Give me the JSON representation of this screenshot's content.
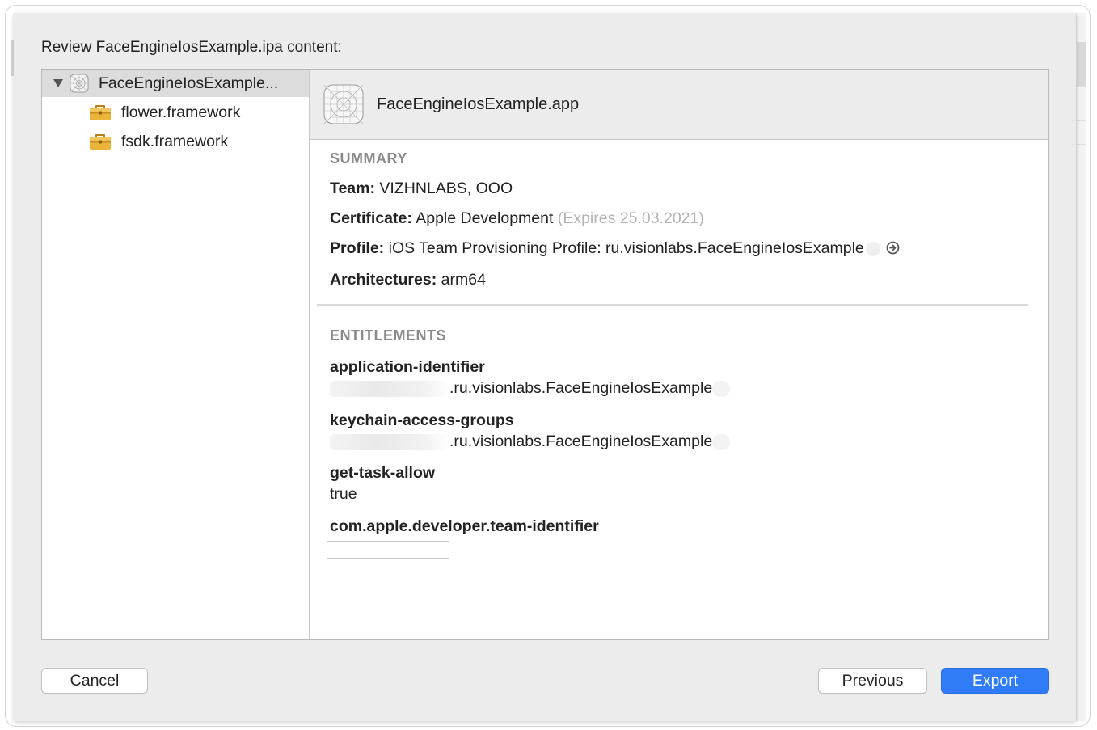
{
  "dialog": {
    "title": "Review FaceEngineIosExample.ipa content:"
  },
  "sidebar": {
    "items": [
      {
        "label": "FaceEngineIosExample...",
        "icon": "app-icon",
        "selected": true,
        "expanded": true
      },
      {
        "label": "flower.framework",
        "icon": "framework-folder-icon"
      },
      {
        "label": "fsdk.framework",
        "icon": "framework-folder-icon"
      }
    ]
  },
  "detail": {
    "header_title": "FaceEngineIosExample.app",
    "summary": {
      "title": "SUMMARY",
      "team_key": "Team:",
      "team_value": "VIZHNLABS, OOO",
      "certificate_key": "Certificate:",
      "certificate_value": "Apple Development",
      "certificate_expires": "(Expires 25.03.2021)",
      "profile_key": "Profile:",
      "profile_value": "iOS Team Provisioning Profile: ru.visionlabs.FaceEngineIosExample",
      "architectures_key": "Architectures:",
      "architectures_value": "arm64"
    },
    "entitlements": {
      "title": "ENTITLEMENTS",
      "items": [
        {
          "key": "application-identifier",
          "value": ".ru.visionlabs.FaceEngineIosExample"
        },
        {
          "key": "keychain-access-groups",
          "value": ".ru.visionlabs.FaceEngineIosExample"
        },
        {
          "key": "get-task-allow",
          "value": "true"
        },
        {
          "key": "com.apple.developer.team-identifier",
          "value": ""
        }
      ]
    }
  },
  "buttons": {
    "cancel": "Cancel",
    "previous": "Previous",
    "export": "Export"
  },
  "colors": {
    "accent": "#2f7cf6",
    "sheet_bg": "#ececec",
    "muted_text": "#b3b3b3",
    "section_title": "#8a8a8a",
    "folder": "#e8a92c"
  }
}
